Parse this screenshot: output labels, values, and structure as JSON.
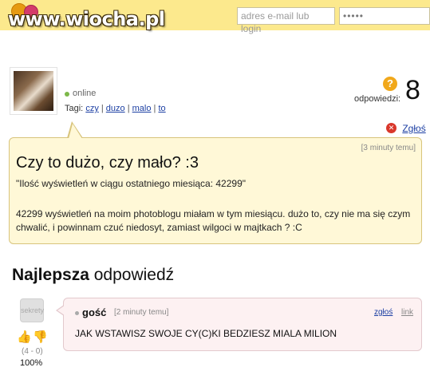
{
  "header": {
    "logo_text": "www.wiocha.pl",
    "email_placeholder": "adres e-mail lub login",
    "password_value": "•••••"
  },
  "user": {
    "status": "online",
    "tags_label": "Tagi:",
    "tags": [
      "czy",
      "duzo",
      "malo",
      "to"
    ],
    "tag_separator": "|"
  },
  "answers": {
    "label": "odpowiedzi:",
    "count": "8",
    "icon": "question-icon"
  },
  "report": {
    "label": "Zgłoś",
    "icon": "close-circle-icon"
  },
  "question": {
    "time": "[3 minuty temu]",
    "title": "Czy to dużo, czy mało? :3",
    "quote": "\"Ilość wyświetleń w ciągu ostatniego miesiąca: 42299\"",
    "body": "42299 wyświetleń na moim photoblogu miałam w tym miesiącu. dużo to, czy nie ma się czym chwalić, i powinnam czuć niedosyt, zamiast wilgoci w majtkach ? :C"
  },
  "best": {
    "heading_bold": "Najlepsza",
    "heading_rest": "odpowiedź",
    "votes": "(4 - 0)",
    "percent": "100%",
    "avatar_text": "sekrety",
    "author": "gość",
    "time": "[2 minuty temu]",
    "report_label": "zgłoś",
    "link_label": "link",
    "text": "JAK WSTAWISZ SWOJE CY(C)KI BEDZIESZ MIALA MILION"
  },
  "colors": {
    "topbar": "#fce98d",
    "question_bg": "#fff8d7",
    "answer_bg": "#fdf1f2",
    "link": "#1c3fa3"
  }
}
